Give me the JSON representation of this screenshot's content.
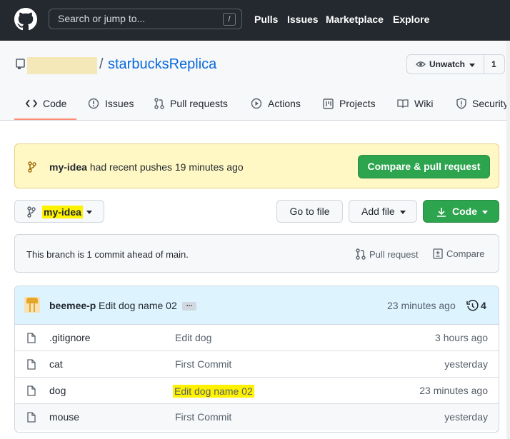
{
  "header": {
    "logo_icon": "github-octocat-icon",
    "search_placeholder": "Search or jump to...",
    "search_shortcut": "/",
    "nav": [
      "Pulls",
      "Issues",
      "Marketplace",
      "Explore"
    ]
  },
  "repo": {
    "separator": "/",
    "name": "starbucksReplica",
    "watch_label": "Unwatch",
    "watch_count": "1"
  },
  "tabs": [
    {
      "label": "Code",
      "icon": "code-icon"
    },
    {
      "label": "Issues",
      "icon": "issue-icon"
    },
    {
      "label": "Pull requests",
      "icon": "pull-request-icon"
    },
    {
      "label": "Actions",
      "icon": "play-icon"
    },
    {
      "label": "Projects",
      "icon": "project-icon"
    },
    {
      "label": "Wiki",
      "icon": "book-icon"
    },
    {
      "label": "Security",
      "icon": "shield-icon"
    }
  ],
  "banner": {
    "branch": "my-idea",
    "message": "had recent pushes 19 minutes ago",
    "button": "Compare & pull request"
  },
  "toolbar": {
    "branch": "my-idea",
    "go_to_file": "Go to file",
    "add_file": "Add file",
    "code": "Code"
  },
  "ahead": {
    "text": "This branch is 1 commit ahead of main.",
    "pull_request": "Pull request",
    "compare": "Compare"
  },
  "commit": {
    "author": "beemee-p",
    "message": "Edit dog name 02",
    "ellipsis": "...",
    "time": "23 minutes ago",
    "count": "4"
  },
  "files": [
    {
      "name": ".gitignore",
      "message": "Edit dog",
      "age": "3 hours ago"
    },
    {
      "name": "cat",
      "message": "First Commit",
      "age": "yesterday"
    },
    {
      "name": "dog",
      "message": "Edit dog name 02",
      "age": "23 minutes ago"
    },
    {
      "name": "mouse",
      "message": "First Commit",
      "age": "yesterday"
    }
  ],
  "colors": {
    "header_bg": "#24292f",
    "link": "#0969da",
    "green": "#2da44e",
    "banner_bg": "#fff8c5",
    "highlight": "#fff200"
  }
}
